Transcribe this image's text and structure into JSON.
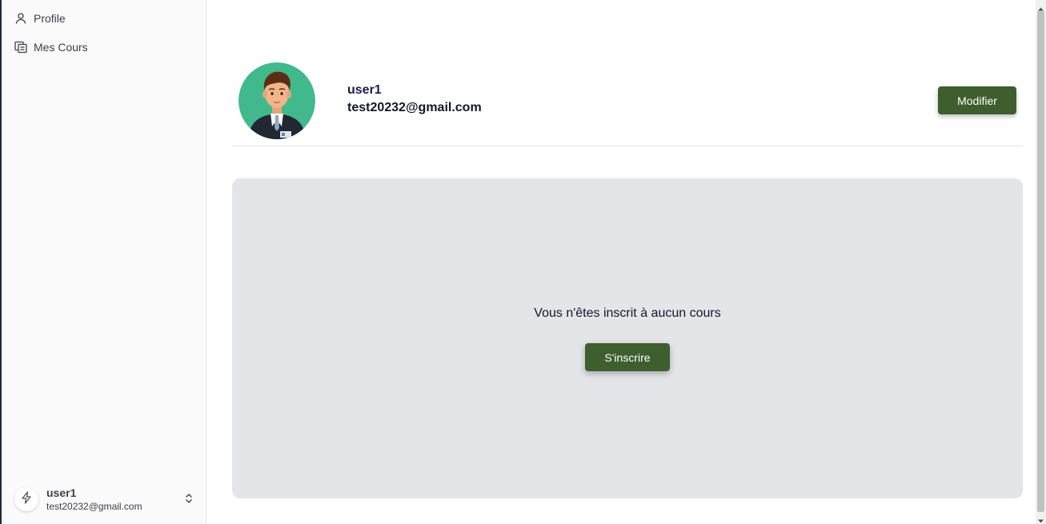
{
  "sidebar": {
    "items": [
      {
        "label": "Profile",
        "icon": "user-icon"
      },
      {
        "label": "Mes Cours",
        "icon": "courses-icon"
      }
    ],
    "footer": {
      "name": "user1",
      "email": "test20232@gmail.com",
      "icon": "lightning-icon"
    }
  },
  "profile": {
    "name": "user1",
    "email": "test20232@gmail.com",
    "edit_label": "Modifier"
  },
  "courses": {
    "empty_message": "Vous n'êtes inscrit à aucun cours",
    "enroll_label": "S'inscrire"
  },
  "colors": {
    "accent": "#3e5e2e",
    "panel": "#e4e5e9",
    "sidebar": "#fafafa",
    "avatar_bg": "#41b98c"
  }
}
